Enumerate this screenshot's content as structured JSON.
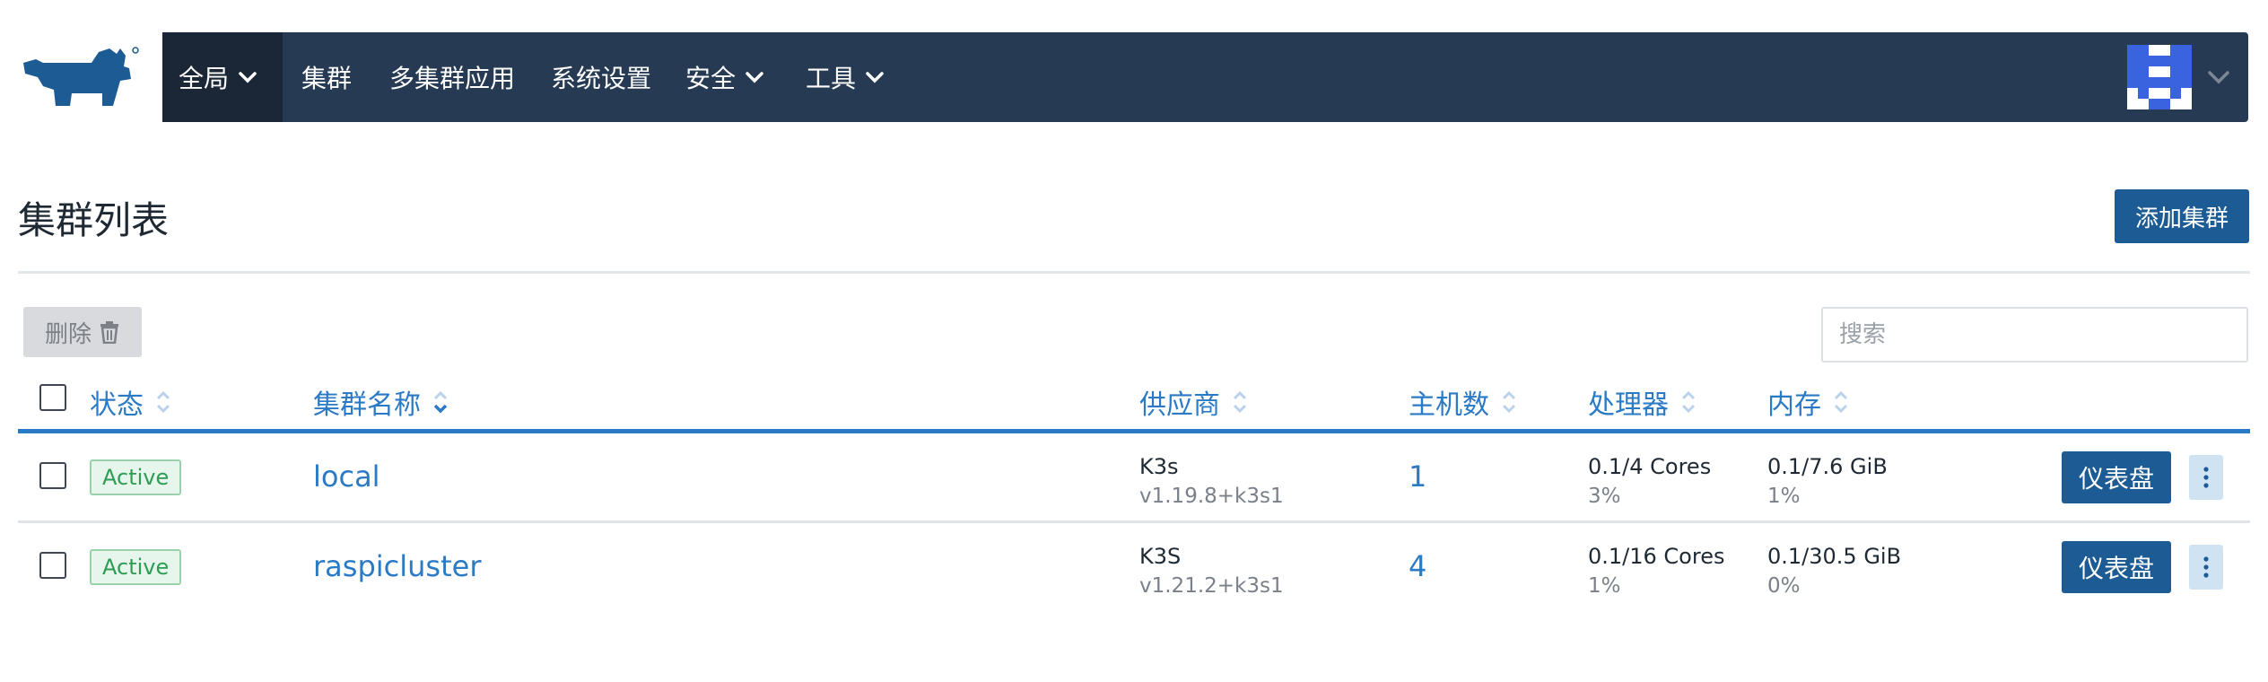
{
  "nav": {
    "items": [
      {
        "label": "全局",
        "dropdown": true,
        "active": true
      },
      {
        "label": "集群",
        "dropdown": false
      },
      {
        "label": "多集群应用",
        "dropdown": false
      },
      {
        "label": "系统设置",
        "dropdown": false
      },
      {
        "label": "安全",
        "dropdown": true
      },
      {
        "label": "工具",
        "dropdown": true
      }
    ],
    "logo_icon": "rancher-cow-icon",
    "avatar_icon": "user-avatar-icon"
  },
  "page": {
    "title": "集群列表",
    "add_button": "添加集群",
    "delete_button": "删除",
    "search_placeholder": "搜索"
  },
  "table": {
    "headers": [
      "状态",
      "集群名称",
      "供应商",
      "主机数",
      "处理器",
      "内存"
    ],
    "rows": [
      {
        "state": "Active",
        "name": "local",
        "provider": "K3s",
        "provider_version": "v1.19.8+k3s1",
        "nodes": "1",
        "cpu": "0.1/4 Cores",
        "cpu_pct": "3%",
        "memory": "0.1/7.6 GiB",
        "memory_pct": "1%",
        "dashboard_button": "仪表盘"
      },
      {
        "state": "Active",
        "name": "raspicluster",
        "provider": "K3S",
        "provider_version": "v1.21.2+k3s1",
        "nodes": "4",
        "cpu": "0.1/16 Cores",
        "cpu_pct": "1%",
        "memory": "0.1/30.5 GiB",
        "memory_pct": "0%",
        "dashboard_button": "仪表盘"
      }
    ]
  },
  "colors": {
    "navbar": "#263a53",
    "nav_active": "#1b2636",
    "primary": "#1c5b93",
    "link": "#2a7ac6",
    "active_badge": "#2f9c53"
  }
}
